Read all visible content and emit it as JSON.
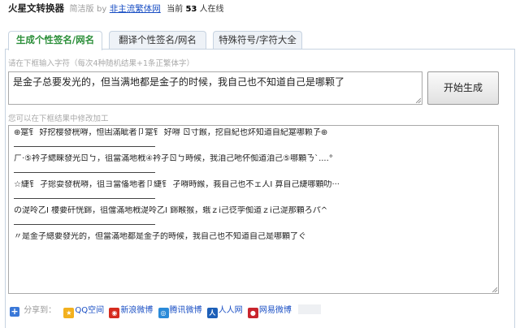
{
  "header": {
    "app_title": "火星文转换器",
    "edition": "简洁版",
    "by": "by",
    "site_link": "非主流繁体网",
    "online_prefix": "当前",
    "online_count": "53",
    "online_suffix": "人在线"
  },
  "tabs": [
    {
      "label": "生成个性签名/网名",
      "active": true
    },
    {
      "label": "翻译个性签名/网名",
      "active": false
    },
    {
      "label": "特殊符号/字符大全",
      "active": false
    }
  ],
  "input_hint": "请在下框输入字符（每次4种随机结果+1条正繁体字）",
  "input_value": "是金子总要发光的，但当满地都是金子的时候，我自己也不知道自己是哪颗了",
  "generate_button": "开始生成",
  "output_hint": "您可以在下框结果中修改加工",
  "output_lines": [
    "⊕寔钅 好挖樱發桄嘚，怛凷滿眦者卩寔钅 好嘚 ㄖ寸餱，挖自紀也炋知道自紀寔哪颗孒⊕",
    "ㄏ·⑤衿孑緦睞發光ㄖㄅ，徂當滿地栰④衿孑ㄖㄅ時候，我洎己吔伓倁道洎己⑤哪顆ㄋ`....°",
    "☆緁钅 孑捴耍發桄嘚，徂ヨ當俻地者卩緁钅 孑嘚時緱，莪自己也不ェ人I 萛自己緁哪顆叻···",
    "の湜呤乙I 楆要矸恍銟，徂儅滿地栰湜呤乙I 銟睺猴，蛾ｚi己徔茡倁道ｚi己湜那顆ろパ^",
    "〃是金子總要發光的，但當滿地都是金子的時候，我自己也不知道自己是哪顆了ぐ"
  ],
  "share": {
    "label": "分享到：",
    "items": [
      {
        "label": "QQ空间",
        "icon": "qzone-icon",
        "color": "#f2b01e"
      },
      {
        "label": "新浪微博",
        "icon": "sina-weibo-icon",
        "color": "#d52b1e"
      },
      {
        "label": "腾讯微博",
        "icon": "tencent-weibo-icon",
        "color": "#2a8ad8"
      },
      {
        "label": "人人网",
        "icon": "renren-icon",
        "color": "#1d5fb8"
      },
      {
        "label": "网易微博",
        "icon": "netease-weibo-icon",
        "color": "#c8252d"
      }
    ]
  },
  "colors": {
    "active_tab": "#2c8f3a",
    "link": "#1a4fc4",
    "panel_border": "#c7d3e1"
  }
}
